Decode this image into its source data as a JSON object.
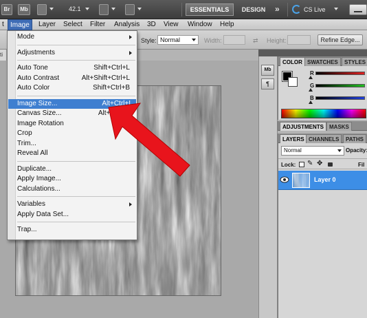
{
  "top_bar": {
    "bridge_label": "Br",
    "minibridge_label": "Mb",
    "zoom_value": "42.1",
    "essentials_label": "ESSENTIALS",
    "design_label": "DESIGN",
    "more_label": "»",
    "cs_live_label": "CS Live"
  },
  "menu_bar": [
    "t",
    "Image",
    "Layer",
    "Select",
    "Filter",
    "Analysis",
    "3D",
    "View",
    "Window",
    "Help"
  ],
  "options_bar": {
    "style_label": "Style:",
    "style_value": "Normal",
    "width_label": "Width:",
    "height_label": "Height:",
    "refine_edge_label": "Refine Edge..."
  },
  "doc_tab_stub": "ti",
  "image_menu": {
    "groups": [
      [
        {
          "label": "Mode",
          "submenu": true
        }
      ],
      [
        {
          "label": "Adjustments",
          "submenu": true
        }
      ],
      [
        {
          "label": "Auto Tone",
          "shortcut": "Shift+Ctrl+L"
        },
        {
          "label": "Auto Contrast",
          "shortcut": "Alt+Shift+Ctrl+L"
        },
        {
          "label": "Auto Color",
          "shortcut": "Shift+Ctrl+B"
        }
      ],
      [
        {
          "label": "Image Size...",
          "shortcut": "Alt+Ctrl+I",
          "highlighted": true
        },
        {
          "label": "Canvas Size...",
          "shortcut": "Alt+Ctrl+C"
        },
        {
          "label": "Image Rotation"
        },
        {
          "label": "Crop"
        },
        {
          "label": "Trim..."
        },
        {
          "label": "Reveal All"
        }
      ],
      [
        {
          "label": "Duplicate..."
        },
        {
          "label": "Apply Image..."
        },
        {
          "label": "Calculations..."
        }
      ],
      [
        {
          "label": "Variables",
          "submenu": true
        },
        {
          "label": "Apply Data Set..."
        }
      ],
      [
        {
          "label": "Trap..."
        }
      ]
    ]
  },
  "color_panel": {
    "tabs": [
      "COLOR",
      "SWATCHES",
      "STYLES"
    ],
    "sliders": [
      {
        "label": "R",
        "color": "#e02020"
      },
      {
        "label": "G",
        "color": "#20c020"
      },
      {
        "label": "B",
        "color": "#2040e0"
      }
    ]
  },
  "adjustments_panel": {
    "tabs": [
      "ADJUSTMENTS",
      "MASKS"
    ]
  },
  "layers_panel": {
    "tabs": [
      "LAYERS",
      "CHANNELS",
      "PATHS"
    ],
    "blend_mode": "Normal",
    "opacity_label": "Opacity:",
    "lock_label": "Lock:",
    "fill_label": "Fil",
    "layer_name": "Layer 0"
  },
  "colors": {
    "menu_highlight": "#3f7fd0",
    "layer_selected": "#3d8ee6",
    "annotation_arrow": "#e8141c"
  }
}
